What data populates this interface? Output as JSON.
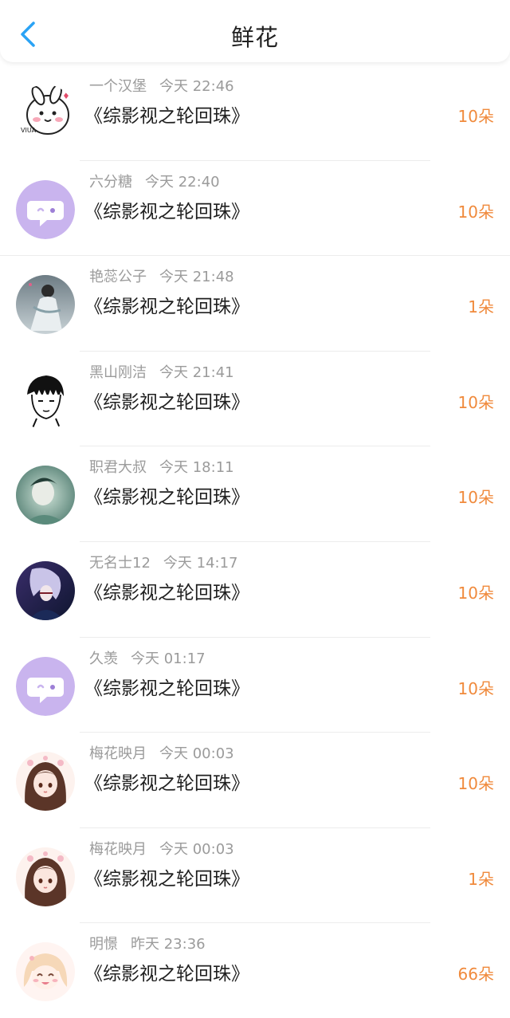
{
  "header": {
    "title": "鲜花",
    "back_icon": "chevron-left-icon",
    "accent": "#2aa3f5"
  },
  "rows": [
    {
      "user": "一个汉堡",
      "time": "今天 22:46",
      "book": "《综影视之轮回珠》",
      "amount": "10朵",
      "avatar": "cartoon-rabbit"
    },
    {
      "user": "六分糖",
      "time": "今天 22:40",
      "book": "《综影视之轮回珠》",
      "amount": "10朵",
      "avatar": "default-purple"
    },
    {
      "user": "艳蕊公子",
      "time": "今天 21:48",
      "book": "《综影视之轮回珠》",
      "amount": "1朵",
      "avatar": "ink-painting"
    },
    {
      "user": "黑山刚洁",
      "time": "今天 21:41",
      "book": "《综影视之轮回珠》",
      "amount": "10朵",
      "avatar": "sketch-face"
    },
    {
      "user": "职君大叔",
      "time": "今天 18:11",
      "book": "《综影视之轮回珠》",
      "amount": "10朵",
      "avatar": "green-portrait"
    },
    {
      "user": "无名士12",
      "time": "今天 14:17",
      "book": "《综影视之轮回珠》",
      "amount": "10朵",
      "avatar": "game-character"
    },
    {
      "user": "久羡",
      "time": "今天 01:17",
      "book": "《综影视之轮回珠》",
      "amount": "10朵",
      "avatar": "default-purple"
    },
    {
      "user": "梅花映月",
      "time": "今天 00:03",
      "book": "《综影视之轮回珠》",
      "amount": "10朵",
      "avatar": "anime-girl"
    },
    {
      "user": "梅花映月",
      "time": "今天 00:03",
      "book": "《综影视之轮回珠》",
      "amount": "1朵",
      "avatar": "anime-girl"
    },
    {
      "user": "明憬",
      "time": "昨天 23:36",
      "book": "《综影视之轮回珠》",
      "amount": "66朵",
      "avatar": "chibi-girl"
    }
  ],
  "colors": {
    "amount": "#f08a3c",
    "meta": "#9b9b9b",
    "default_avatar": "#c9b4ee"
  }
}
